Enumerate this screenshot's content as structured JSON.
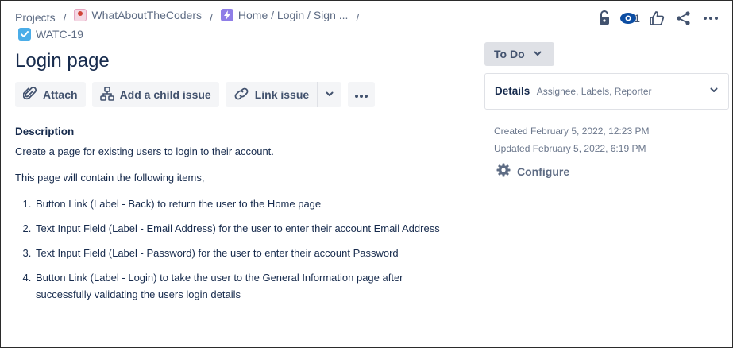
{
  "breadcrumb": {
    "projects": "Projects",
    "project": "WhatAboutTheCoders",
    "epic": "Home / Login / Sign ...",
    "separator": "/",
    "issue_key": "WATC-19"
  },
  "header": {
    "watch_count": "1",
    "title": "Login page"
  },
  "actions": {
    "attach": "Attach",
    "add_child": "Add a child issue",
    "link_issue": "Link issue"
  },
  "description": {
    "heading": "Description",
    "intro": "Create a page for existing users to login to their account.",
    "list_intro": "This page will contain the following items,",
    "items": [
      "Button Link (Label - Back) to return the user to the Home page",
      "Text Input Field (Label - Email Address) for the user to enter their account Email Address",
      "Text Input Field (Label - Password) for the user to enter their account Password",
      "Button Link (Label - Login) to take the user to the General Information page after successfully validating the users login details"
    ]
  },
  "sidebar": {
    "status": "To Do",
    "details_title": "Details",
    "details_subtitle": "Assignee, Labels, Reporter",
    "created": "Created February 5, 2022, 12:23 PM",
    "updated": "Updated February 5, 2022, 6:19 PM",
    "configure": "Configure"
  },
  "colors": {
    "text": "#172b4d",
    "muted": "#5e6c84",
    "button_bg": "#f4f5f7",
    "status_bg": "#dfe1e6",
    "epic": "#8f7ee7",
    "task": "#4bade8"
  }
}
